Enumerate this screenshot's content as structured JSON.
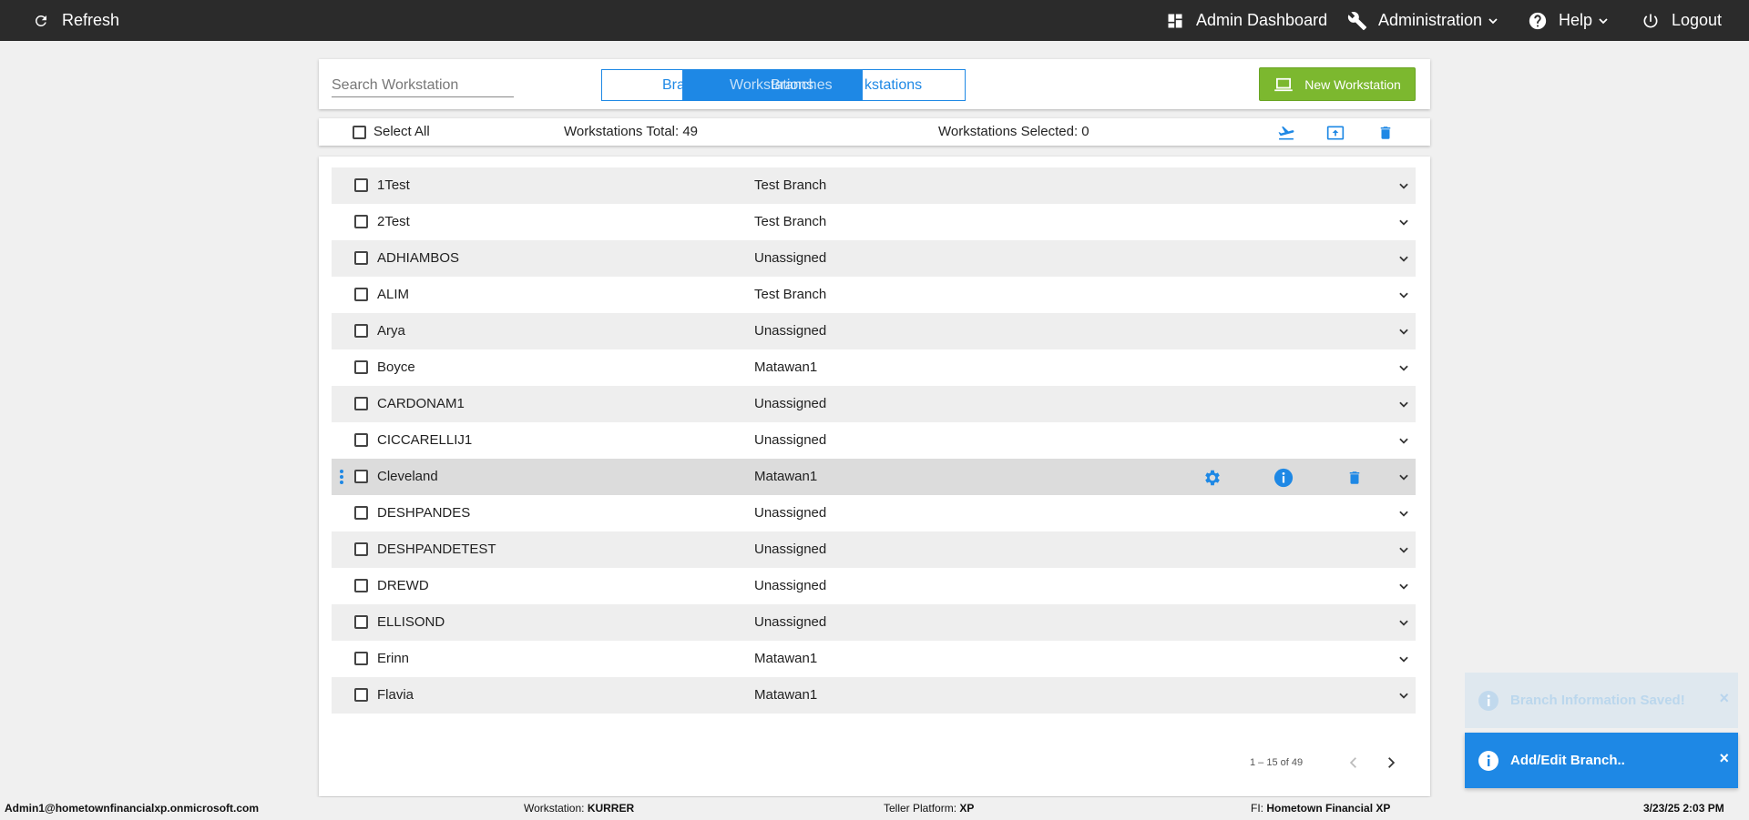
{
  "topbar": {
    "refresh_label": "Refresh",
    "admin_dashboard_label": "Admin Dashboard",
    "administration_label": "Administration",
    "help_label": "Help",
    "logout_label": "Logout"
  },
  "header": {
    "search_placeholder": "Search Workstation",
    "tabs": {
      "left_partial": "Bra",
      "right_partial": "kstations",
      "ghost_text_1": "Workstations",
      "ghost_text_2": "Branches"
    },
    "new_button_label": "New Workstation"
  },
  "toolbar": {
    "select_all_label": "Select All",
    "total_text": "Workstations Total: 49",
    "selected_text": "Workstations Selected: 0",
    "icons": [
      "airplane-takeoff-icon",
      "upload-icon",
      "trash-icon"
    ]
  },
  "rows": [
    {
      "name": "1Test",
      "branch": "Test Branch"
    },
    {
      "name": "2Test",
      "branch": "Test Branch"
    },
    {
      "name": "ADHIAMBOS",
      "branch": "Unassigned"
    },
    {
      "name": "ALIM",
      "branch": "Test Branch"
    },
    {
      "name": "Arya",
      "branch": "Unassigned"
    },
    {
      "name": "Boyce",
      "branch": "Matawan1"
    },
    {
      "name": "CARDONAM1",
      "branch": "Unassigned"
    },
    {
      "name": "CICCARELLIJ1",
      "branch": "Unassigned"
    },
    {
      "name": "Cleveland",
      "branch": "Matawan1"
    },
    {
      "name": "DESHPANDES",
      "branch": "Unassigned"
    },
    {
      "name": "DESHPANDETEST",
      "branch": "Unassigned"
    },
    {
      "name": "DREWD",
      "branch": "Unassigned"
    },
    {
      "name": "ELLISOND",
      "branch": "Unassigned"
    },
    {
      "name": "Erinn",
      "branch": "Matawan1"
    },
    {
      "name": "Flavia",
      "branch": "Matawan1"
    }
  ],
  "pager": {
    "range_text": "1 – 15 of 49"
  },
  "toasts": {
    "faded_title": "Branch Information Saved!",
    "main_title": "Add/Edit Branch..",
    "close_glyph": "×"
  },
  "statusbar": {
    "user": "Admin1@hometownfinancialxp.onmicrosoft.com",
    "workstation_label": "Workstation:",
    "workstation_value": "KURRER",
    "platform_label": "Teller Platform:",
    "platform_value": "XP",
    "fi_label": "FI:",
    "fi_value": "Hometown Financial XP",
    "datetime": "3/23/25 2:03 PM"
  },
  "colors": {
    "accent": "#1e88e5",
    "new_button": "#7cb82f",
    "topbar": "#2b2b2b"
  }
}
